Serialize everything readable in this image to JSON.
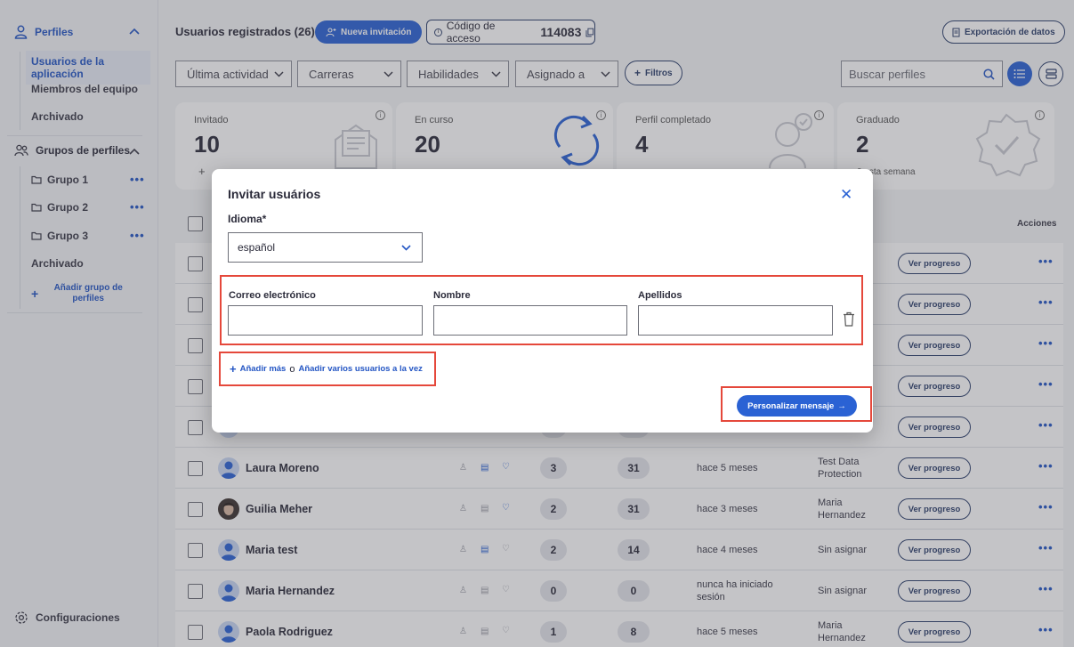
{
  "sidebar": {
    "profiles_label": "Perfiles",
    "items": [
      "Usuarios de la aplicación",
      "Miembros del equipo",
      "Archivado"
    ],
    "groups_label": "Grupos de perfiles",
    "groups": [
      "Grupo 1",
      "Grupo 2",
      "Grupo 3"
    ],
    "groups_archived": "Archivado",
    "add_group": "Añadir grupo de perfiles",
    "settings": "Configuraciones",
    "more_icon": "•••"
  },
  "header": {
    "title": "Usuarios registrados (26)",
    "invite_button": "Nueva invitación",
    "access_code_label": "Código de acceso",
    "access_code": "114083",
    "export_button": "Exportación de datos"
  },
  "filters": {
    "last_activity": "Última actividad",
    "careers": "Carreras",
    "skills": "Habilidades",
    "assigned_to": "Asignado a",
    "filters_button": "Filtros",
    "search_placeholder": "Buscar perfiles"
  },
  "stats": [
    {
      "label": "Invitado",
      "value": "10"
    },
    {
      "label": "En curso",
      "value": "20"
    },
    {
      "label": "Perfil completado",
      "value": "4"
    },
    {
      "label": "Graduado",
      "value": "2",
      "note": "0 esta semana"
    }
  ],
  "table": {
    "actions_header": "Acciones",
    "view_progress": "Ver progreso",
    "rows": [
      {
        "name": "Laura Moreno",
        "c1": "3",
        "c2": "31",
        "last": "hace 5 meses",
        "assigned": "Test Data Protection"
      },
      {
        "name": "Guilia Meher",
        "c1": "2",
        "c2": "31",
        "last": "hace 3 meses",
        "assigned": "Maria Hernandez"
      },
      {
        "name": "Maria test",
        "c1": "2",
        "c2": "14",
        "last": "hace 4 meses",
        "assigned": "Sin asignar"
      },
      {
        "name": "Maria Hernandez",
        "c1": "0",
        "c2": "0",
        "last": "nunca ha iniciado sesión",
        "assigned": "Sin asignar"
      },
      {
        "name": "Paola Rodriguez",
        "c1": "1",
        "c2": "8",
        "last": "hace 5 meses",
        "assigned": "Maria Hernandez"
      }
    ]
  },
  "modal": {
    "title": "Invitar usuários",
    "language_label": "Idioma*",
    "language_value": "español",
    "email_label": "Correo electrónico",
    "first_name_label": "Nombre",
    "last_name_label": "Apellidos",
    "add_more": "Añadir más",
    "or": "o",
    "add_bulk": "Añadir varios usuarios a la vez",
    "customize_button": "Personalizar mensaje",
    "customize_arrow": "→"
  },
  "colors": {
    "accent": "#2a62d4",
    "highlight": "#e5483b"
  }
}
